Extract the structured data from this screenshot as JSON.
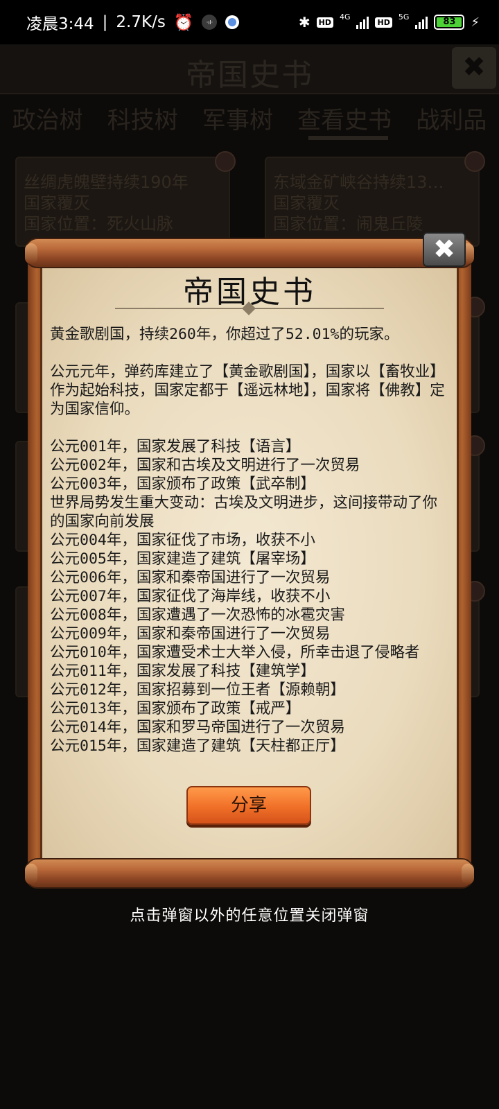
{
  "status_bar": {
    "time": "凌晨3:44",
    "speed": "2.7K/s",
    "net1": "4G",
    "net2": "5G",
    "hd": "HD",
    "battery": "83"
  },
  "background": {
    "title": "帝国史书",
    "tabs": [
      "政治树",
      "科技树",
      "军事树",
      "查看史书",
      "战利品"
    ],
    "cards": [
      {
        "lines": [
          "丝绸虎魄壁持续190年",
          "国家覆灭",
          "国家位置：死火山脉"
        ]
      },
      {
        "lines": [
          "东域金矿峡谷持续13…",
          "国家覆灭",
          "国家位置：闹鬼丘陵"
        ]
      }
    ]
  },
  "dialog": {
    "title": "帝国史书",
    "close_label": "✖",
    "summary": "黄金歌剧国，持续260年，你超过了52.01%的玩家。",
    "intro": "公元元年，弹药库建立了【黄金歌剧国】，国家以【畜牧业】作为起始科技，国家定都于【遥远林地】，国家将【佛教】定为国家信仰。",
    "events": [
      "公元001年，国家发展了科技【语言】",
      "公元002年，国家和古埃及文明进行了一次贸易",
      "公元003年，国家颁布了政策【武卒制】",
      "世界局势发生重大变动：古埃及文明进步，这间接带动了你的国家向前发展",
      "公元004年，国家征伐了市场，收获不小",
      "公元005年，国家建造了建筑【屠宰场】",
      "公元006年，国家和秦帝国进行了一次贸易",
      "公元007年，国家征伐了海岸线，收获不小",
      "公元008年，国家遭遇了一次恐怖的冰雹灾害",
      "公元009年，国家和秦帝国进行了一次贸易",
      "公元010年，国家遭受术士大举入侵，所幸击退了侵略者",
      "公元011年，国家发展了科技【建筑学】",
      "公元012年，国家招募到一位王者【源赖朝】",
      "公元013年，国家颁布了政策【戒严】",
      "公元014年，国家和罗马帝国进行了一次贸易",
      "公元015年，国家建造了建筑【天柱都正厅】"
    ],
    "share_label": "分享"
  },
  "hint": "点击弹窗以外的任意位置关闭弹窗"
}
